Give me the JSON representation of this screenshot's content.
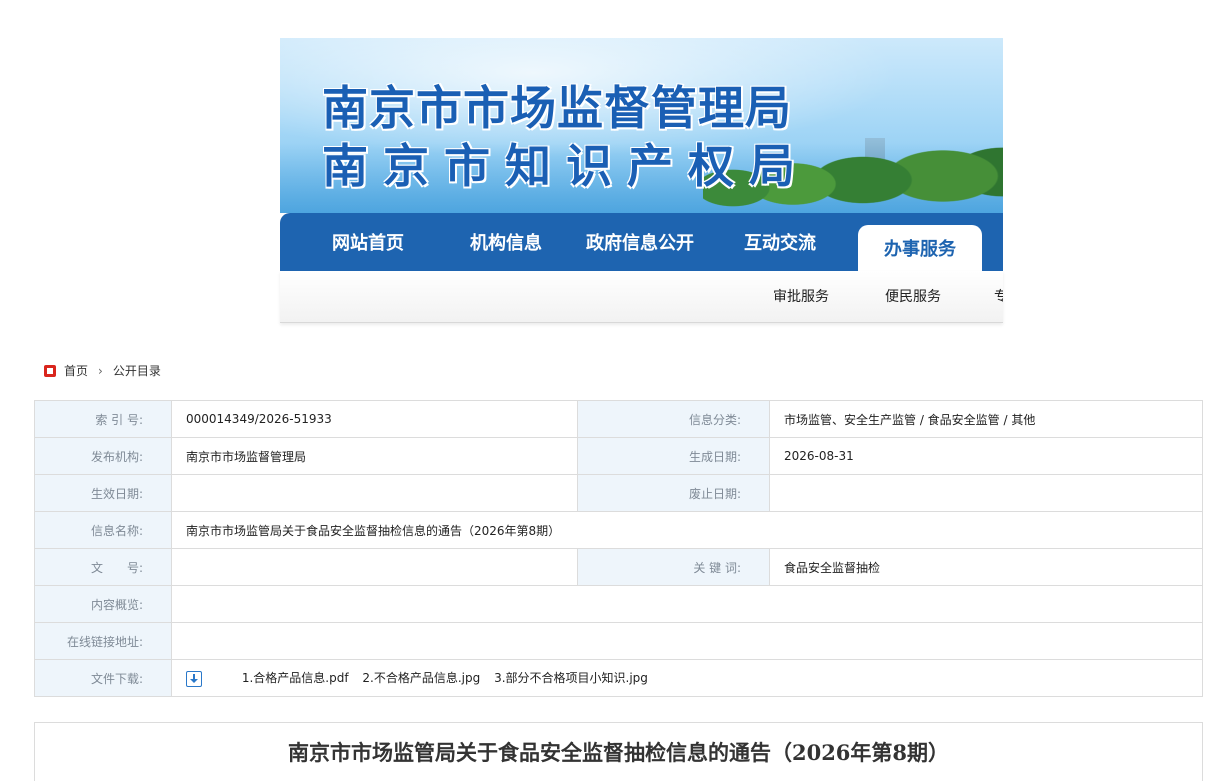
{
  "header": {
    "title_line1": "南京市市场监督管理局",
    "title_line2": "南京市知识产权局"
  },
  "nav": {
    "items": [
      "网站首页",
      "机构信息",
      "政府信息公开",
      "互动交流",
      "办事服务"
    ],
    "active_index": 4
  },
  "subnav": {
    "items": [
      "审批服务",
      "便民服务",
      "专"
    ]
  },
  "breadcrumb": {
    "home": "首页",
    "separator": "›",
    "current": "公开目录"
  },
  "meta": {
    "index_label": "索 引 号:",
    "index_value": "000014349/2026-51933",
    "category_label": "信息分类:",
    "category_value": "市场监管、安全生产监管 / 食品安全监管 / 其他",
    "publisher_label": "发布机构:",
    "publisher_value": "南京市市场监督管理局",
    "created_label": "生成日期:",
    "created_value": "2026-08-31",
    "effective_label": "生效日期:",
    "effective_value": "",
    "expire_label": "废止日期:",
    "expire_value": "",
    "name_label": "信息名称:",
    "name_value": "南京市市场监管局关于食品安全监督抽检信息的通告（2026年第8期）",
    "docno_label": "文　　号:",
    "docno_value": "",
    "keywords_label": "关 键 词:",
    "keywords_value": "食品安全监督抽检",
    "summary_label": "内容概览:",
    "summary_value": "",
    "link_label": "在线链接地址:",
    "link_value": "",
    "download_label": "文件下载:",
    "files": [
      "1.合格产品信息.pdf",
      "2.不合格产品信息.jpg",
      "3.部分不合格项目小知识.jpg"
    ]
  },
  "article": {
    "title": "南京市市场监管局关于食品安全监督抽检信息的通告（2026年第8期）"
  },
  "colors": {
    "brand_blue": "#1e64b0",
    "label_bg": "#eef5fb",
    "breadcrumb_icon": "#d9251d"
  }
}
